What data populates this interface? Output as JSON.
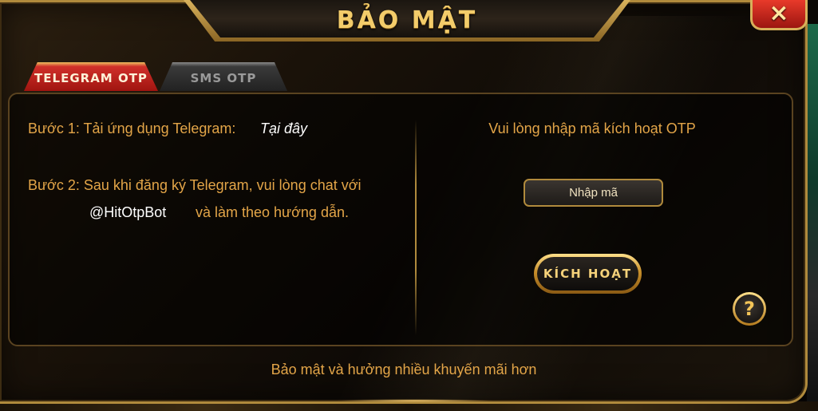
{
  "dialog": {
    "title": "BẢO MẬT",
    "close_icon": "×",
    "close_icon_name": "close-icon"
  },
  "tabs": [
    {
      "label": "TELEGRAM OTP",
      "active": true
    },
    {
      "label": "SMS OTP",
      "active": false
    }
  ],
  "instructions": {
    "step1_text": "Bước 1: Tải ứng dụng Telegram:",
    "step1_link": "Tại đây",
    "step2_line1": "Bước 2: Sau khi đăng ký Telegram, vui lòng chat với",
    "step2_bot": "@HitOtpBot",
    "step2_line2_rest": "và làm theo hướng dẫn."
  },
  "otp": {
    "prompt": "Vui lòng nhập mã kích hoạt OTP",
    "input_placeholder": "Nhập mã",
    "activate_label": "KÍCH HOẠT",
    "help_label": "?"
  },
  "footer": {
    "text": "Bảo mật và hưởng nhiều khuyến mãi hơn"
  },
  "colors": {
    "accent_gold": "#e3a548",
    "title_gold": "#f3cc6a",
    "active_tab_red": "#a01510",
    "close_red": "#e83a2a"
  }
}
